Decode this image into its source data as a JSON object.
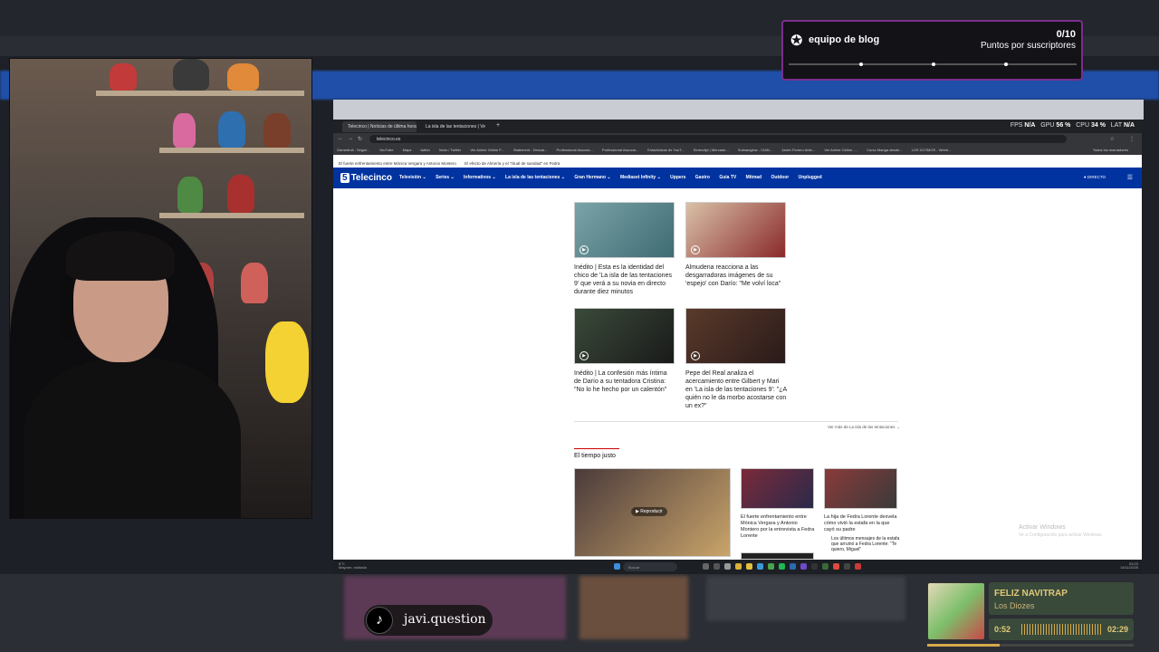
{
  "notification": {
    "icon": "star-badge-icon",
    "title": "equipo de blog",
    "count": "0/10",
    "subtitle": "Puntos por suscriptores",
    "progress": 0
  },
  "browser": {
    "tabs": [
      {
        "label": "Telecinco | Noticias de última hora"
      },
      {
        "label": "La isla de las tentaciones | Ve"
      }
    ],
    "new_tab": "+",
    "url": "telecinco.es",
    "perf": {
      "fps_label": "FPS",
      "fps": "N/A",
      "gpu_label": "GPU",
      "gpu": "56 %",
      "cpu_label": "CPU",
      "cpu": "34 %",
      "lat_label": "LAT",
      "lat": "N/A"
    },
    "bookmarks": [
      "Gamedroll - Seguir...",
      "YouTube",
      "Maps",
      "twitch",
      "Inicio / Twitter",
      "Ver Anime Online F...",
      "Statement - Descar...",
      "Professional Associa...",
      "Professional Associa...",
      "Estadísticas de YouT...",
      "Serendipi | Mercado...",
      "Subsanglow - CIAN...",
      "Javier Florero Ante...",
      "Ver Anime Online -...",
      "Curso Manga desde...",
      "LOS ÚLTIMOS - Weeb..."
    ],
    "bookmarks_right": "Todos los marcadores"
  },
  "site": {
    "news_ticker": [
      "El fuerte enfrentamiento entre Mónica Vergara y Antonio Montero",
      "El efecto de Almería y el \"ritual de sanidad\" en Fedra"
    ],
    "logo_mark": "5",
    "logo_text": "Telecinco",
    "menu": [
      "Televisión ⌄",
      "Series ⌄",
      "Informativos ⌄",
      "La isla de las tentaciones ⌄",
      "Gran Hermano ⌄",
      "Mediaset Infinity ⌄",
      "Uppers",
      "Gastro",
      "Guía TV",
      "Mitmad",
      "Outdoor",
      "Unplugged"
    ],
    "directo": "● DIRECTO",
    "cards": [
      {
        "text": "Inédito | Esta es la identidad del chico de 'La isla de las tentaciones 9' que verá a su novia en directo durante diez minutos"
      },
      {
        "text": "Almudena reacciona a las desgarradoras imágenes de su 'espejo' con Darío: \"Me volví loca\""
      },
      {
        "text": "Inédito | La confesión más íntima de Darío a su tentadora Cristina: \"No lo he hecho por un calentón\""
      },
      {
        "text": "Pepe del Real analiza el acercamiento entre Gilbert y Mari en 'La isla de las tentaciones 9': \"¿A quién no le da morbo acostarse con un ex?\""
      }
    ],
    "more_link": "Ver más de La isla de las tentaciones →",
    "section_title": "El tiempo justo",
    "reproducir": "▶ Reproducir",
    "tj_cards": [
      {
        "text": "El fuerte enfrentamiento entre Mónica Vergara y Antonio Montero por la entrevista a Fedra Lorente"
      },
      {
        "text": "La hija de Fedra Lorente desvela cómo vivió la estafa en la que cayó su padre"
      },
      {
        "text": "Los últimos mensajes de la estafa que arruinó a Fedra Lorente: \"Te quiero, Miguel\""
      }
    ],
    "watermark_title": "Activar Windows",
    "watermark_sub": "Ve a Configuración para activar Windows."
  },
  "taskbar": {
    "weather_temp": "8°C",
    "weather_desc": "Mayorm. nublado",
    "search_placeholder": "Buscar",
    "time": "03:23",
    "date": "16/11/2025"
  },
  "tiktok": {
    "icon": "tiktok-logo-icon",
    "handle": "javi.question"
  },
  "music": {
    "title": "FELIZ NAVITRAP",
    "artist": "Los Diozes",
    "elapsed": "0:52",
    "total": "02:29",
    "progress": 0.35
  }
}
